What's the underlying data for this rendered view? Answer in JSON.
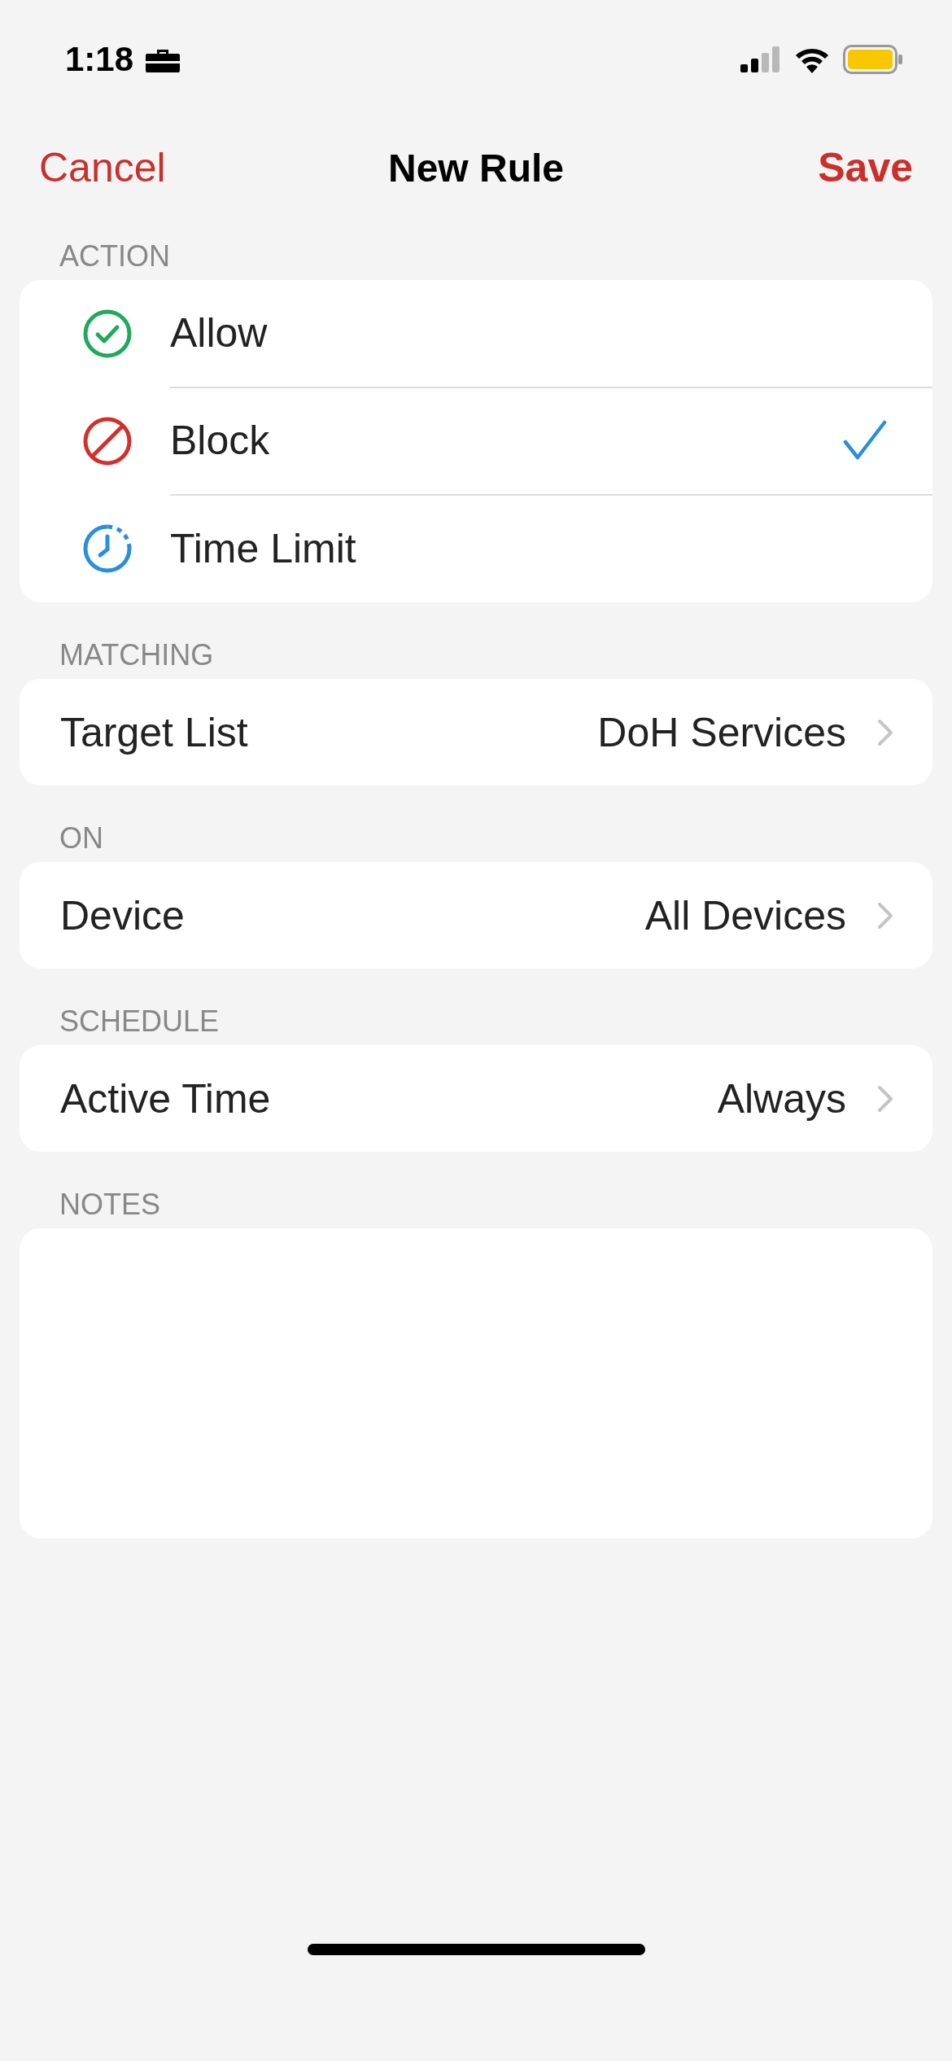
{
  "status_bar": {
    "time": "1:18"
  },
  "nav": {
    "cancel": "Cancel",
    "title": "New Rule",
    "save": "Save"
  },
  "action_section": {
    "header": "ACTION",
    "options": [
      {
        "kind": "allow",
        "label": "Allow",
        "selected": false
      },
      {
        "kind": "block",
        "label": "Block",
        "selected": true
      },
      {
        "kind": "time_limit",
        "label": "Time Limit",
        "selected": false
      }
    ]
  },
  "sections": [
    {
      "header": "MATCHING",
      "label": "Target List",
      "value": "DoH Services"
    },
    {
      "header": "ON",
      "label": "Device",
      "value": "All Devices"
    },
    {
      "header": "SCHEDULE",
      "label": "Active Time",
      "value": "Always"
    }
  ],
  "notes": {
    "header": "NOTES"
  }
}
